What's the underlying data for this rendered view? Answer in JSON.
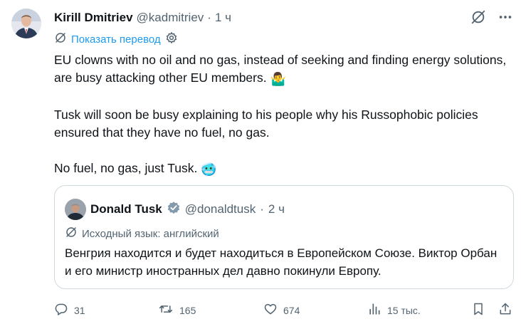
{
  "tweet": {
    "author_name": "Kirill Dmitriev",
    "author_handle": "@kadmitriev",
    "separator": "·",
    "time": "1 ч",
    "translate_label": "Показать перевод",
    "paragraphs": [
      "EU clowns with no oil and no gas, instead of seeking and finding energy solutions, are busy attacking other EU members.",
      "Tusk will soon be busy explaining to his people why his Russophobic policies ensured that they have no fuel, no gas.",
      "No fuel, no gas, just Tusk."
    ],
    "emojis": [
      "🤷‍♂️",
      "🥶"
    ]
  },
  "quote": {
    "author_name": "Donald Tusk",
    "author_handle": "@donaldtusk",
    "separator": "·",
    "time": "2 ч",
    "source_language": "Исходный язык: английский",
    "text": "Венгрия находится и будет находиться в Европейском Союзе. Виктор Орбан и его министр иностранных дел давно покинули Европу."
  },
  "actions": {
    "replies": "31",
    "reposts": "165",
    "likes": "674",
    "views": "15 тыс."
  },
  "icons": {
    "top": [
      "grok-icon",
      "more-icon"
    ],
    "translate": "translate-icon",
    "settings": "gear-icon",
    "verified": "verified-badge-icon",
    "actions": [
      "reply-icon",
      "repost-icon",
      "like-icon",
      "views-icon",
      "bookmark-icon",
      "share-icon"
    ]
  },
  "colors": {
    "link": "#1d9bf0",
    "muted": "#536471",
    "text": "#0f1419",
    "border": "#cfd9de",
    "verified_badge": "#829aab"
  }
}
